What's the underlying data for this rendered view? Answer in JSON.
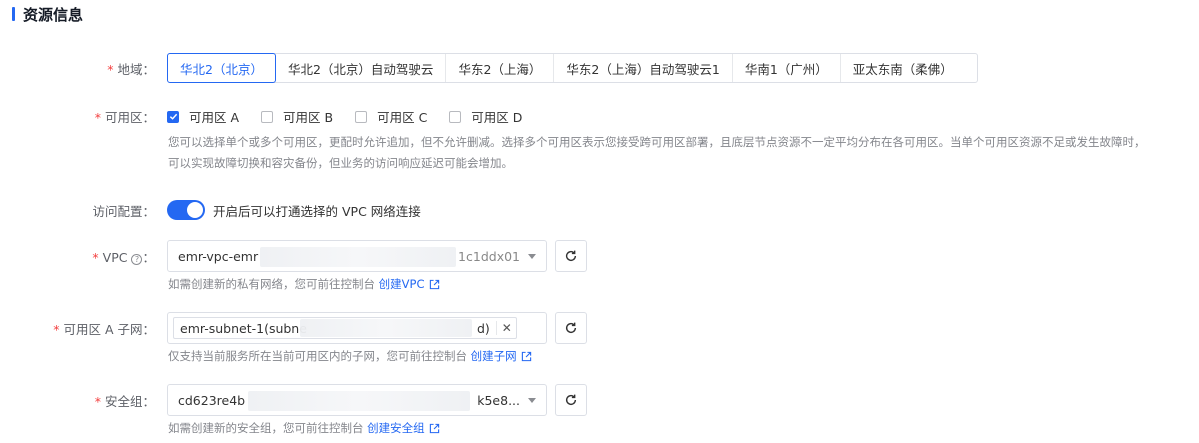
{
  "section": {
    "title": "资源信息"
  },
  "colors": {
    "accent": "#2468f2",
    "required": "#f33e3e"
  },
  "region": {
    "label": "地域：",
    "options": [
      "华北2（北京）",
      "华北2（北京）自动驾驶云",
      "华东2（上海）",
      "华东2（上海）自动驾驶云1",
      "华南1（广州）",
      "亚太东南（柔佛）"
    ],
    "selected": "华北2（北京）"
  },
  "zone": {
    "label": "可用区：",
    "options": [
      {
        "label": "可用区 A",
        "checked": true
      },
      {
        "label": "可用区 B",
        "checked": false
      },
      {
        "label": "可用区 C",
        "checked": false
      },
      {
        "label": "可用区 D",
        "checked": false
      }
    ],
    "help_line1": "您可以选择单个或多个可用区，更配时允许追加，但不允许删减。选择多个可用区表示您接受跨可用区部署，且底层节点资源不一定平均分布在各可用区。当单个可用区资源不足或发生故障时，",
    "help_line2": "可以实现故障切换和容灾备份，但业务的访问响应延迟可能会增加。"
  },
  "access": {
    "label": "访问配置：",
    "enabled": true,
    "switch_text": "开启后可以打通选择的 VPC 网络连接"
  },
  "vpc": {
    "label": "VPC",
    "value_prefix": "emr-vpc-emr",
    "value_suffix": "1c1ddx01",
    "help": "如需创建新的私有网络，您可前往控制台",
    "link": "创建VPC"
  },
  "subnet": {
    "label": "可用区 A 子网：",
    "tag_prefix": "emr-subnet-1(subne",
    "tag_suffix": "d)",
    "help": "仅支持当前服务所在当前可用区内的子网，您可前往控制台",
    "link": "创建子网"
  },
  "security_group": {
    "label": "安全组：",
    "value_prefix": "cd623re4b",
    "value_suffix": "k5e8...",
    "help": "如需创建新的安全组，您可前往控制台",
    "link": "创建安全组"
  }
}
